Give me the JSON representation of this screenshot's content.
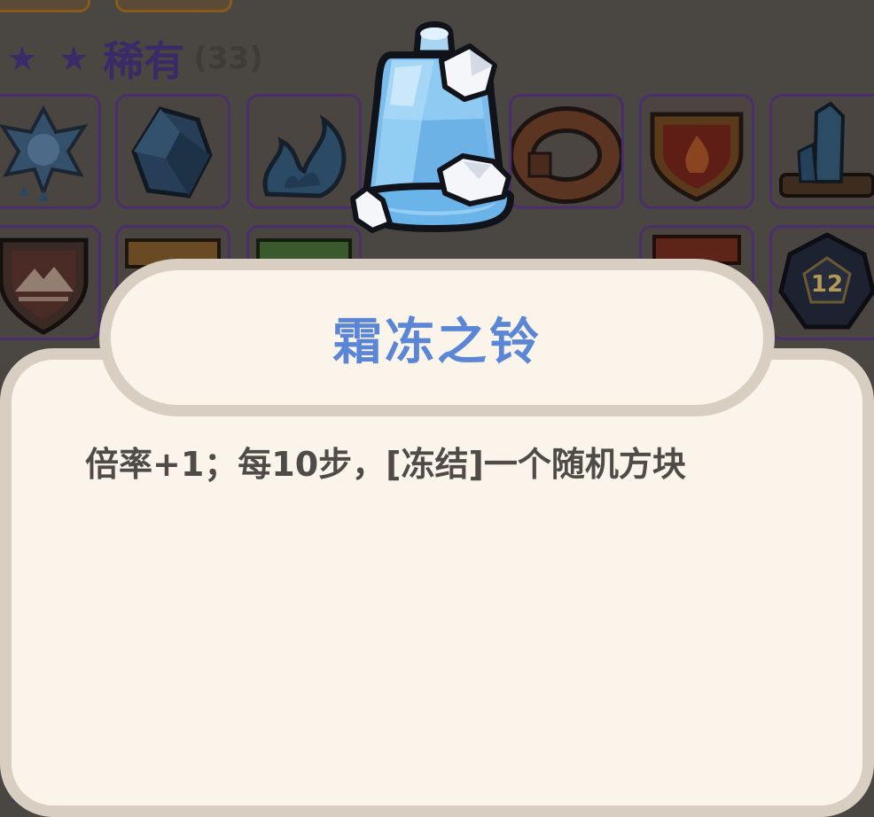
{
  "section": {
    "stars": "★ ★",
    "rarity_title": "稀有",
    "rarity_count": "(33)"
  },
  "dialog": {
    "title": "霜冻之铃",
    "description": "倍率+1；每10步，[冻结]一个随机方块"
  },
  "grid": {
    "row1": [
      "frost-emblem-icon",
      "sapphire-gem-icon",
      "blue-flame-icon",
      "",
      "leather-ring-icon",
      "fire-shield-icon",
      "crystal-pillar-icon"
    ],
    "row2": [
      "mountain-shield-icon",
      "book-icon",
      "green-shield-icon",
      "",
      "",
      "red-book-icon",
      "d12-dice-icon"
    ],
    "dice_label": "12"
  },
  "colors": {
    "title": "#5b86d6",
    "dialog_bg": "#fbf4ea",
    "dialog_border": "#d8cfc2",
    "rarity": "#3b2a68"
  },
  "featured_item_icon": "frost-bell-icon"
}
